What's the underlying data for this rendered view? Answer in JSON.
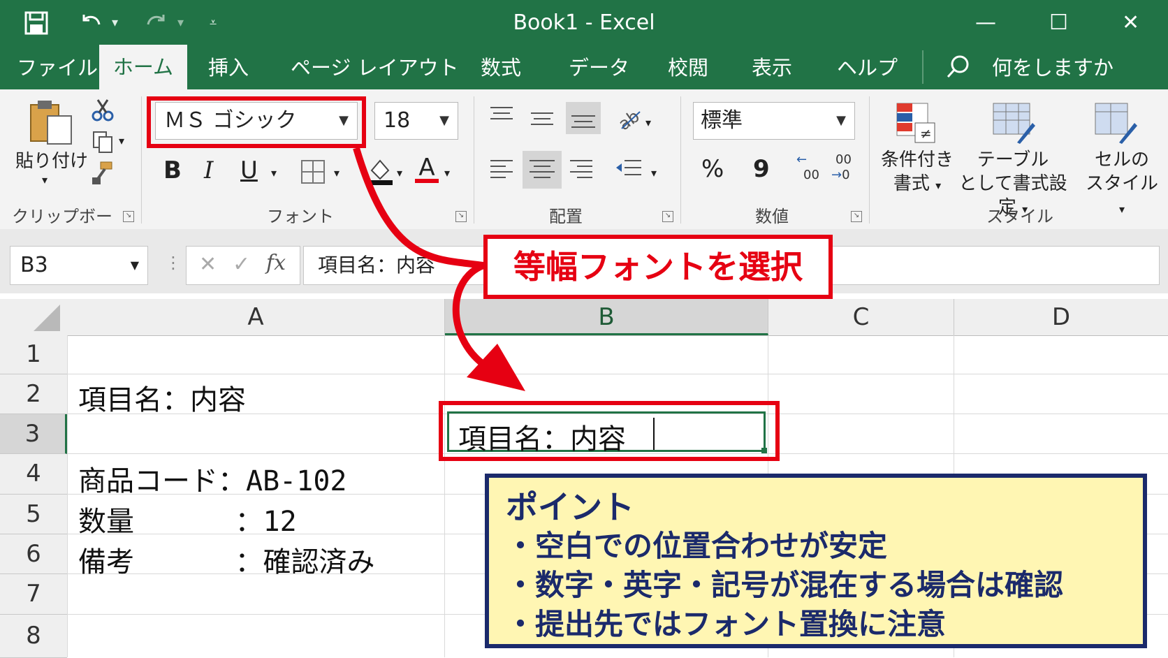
{
  "window": {
    "title": "Book1  -  Excel",
    "quick_access": {
      "save_icon": "save-icon",
      "undo_icon": "undo-icon",
      "redo_icon": "redo-icon",
      "customize_icon": "customize-qat-icon"
    },
    "controls": {
      "minimize": "—",
      "maximize": "☐",
      "close": "✕"
    }
  },
  "tabs": [
    {
      "label": "ファイル"
    },
    {
      "label": "ホーム",
      "active": true
    },
    {
      "label": "挿入"
    },
    {
      "label": "ページ レイアウト"
    },
    {
      "label": "数式"
    },
    {
      "label": "データ"
    },
    {
      "label": "校閲"
    },
    {
      "label": "表示"
    },
    {
      "label": "ヘルプ"
    }
  ],
  "tell_me": "何をしますか",
  "ribbon": {
    "clipboard": {
      "paste_label": "貼り付け",
      "group_label": "クリップボード"
    },
    "font": {
      "font_name": "ＭＳ ゴシック",
      "font_size": "18",
      "bold": "B",
      "italic": "I",
      "underline": "U",
      "font_color_letter": "A",
      "group_label": "フォント"
    },
    "alignment": {
      "group_label": "配置"
    },
    "number": {
      "format": "標準",
      "percent": "%",
      "comma": "9",
      "inc_decimal_top": "00",
      "inc_decimal_bottom": ".0",
      "dec_decimal_top": "00",
      "dec_decimal_bottom": "0",
      "group_label": "数値"
    },
    "styles": {
      "conditional_line1": "条件付き",
      "conditional_line2": "書式",
      "table_line1": "テーブル",
      "table_line2": "として書式設定",
      "cell_line1": "セルの",
      "cell_line2": "スタイル",
      "group_label": "スタイル"
    }
  },
  "formula_bar": {
    "name_box": "B3",
    "cancel": "✕",
    "enter": "✓",
    "fx": "fx",
    "content": "項目名：内容"
  },
  "grid": {
    "columns": [
      "A",
      "B",
      "C",
      "D"
    ],
    "rows": [
      "1",
      "2",
      "3",
      "4",
      "5",
      "6",
      "7",
      "8"
    ],
    "cells": {
      "A2": "項目名：内容",
      "B3": "項目名：内容",
      "A4": "商品コード：AB-102",
      "A5": "数量      ：12",
      "A6": "備考      ：確認済み"
    }
  },
  "annotations": {
    "callout": "等幅フォントを選択",
    "point_title": "ポイント",
    "points": [
      "・空白での位置合わせが安定",
      "・数字・英字・記号が混在する場合は確認",
      "・提出先ではフォント置換に注意"
    ],
    "accent_red": "#e60012",
    "excel_green": "#217346",
    "point_bg": "#fff6b3",
    "point_border": "#1b2a6b"
  }
}
